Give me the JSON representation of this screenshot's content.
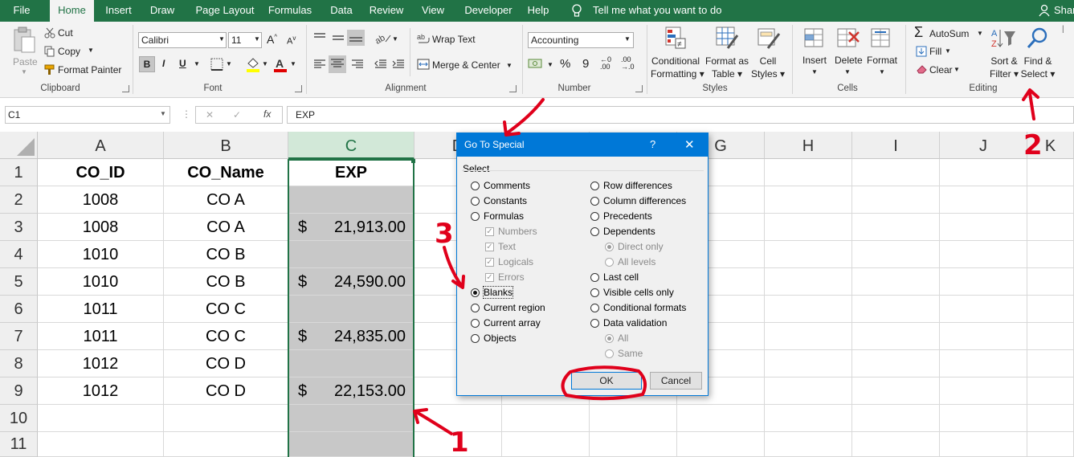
{
  "menu": [
    "File",
    "Home",
    "Insert",
    "Draw",
    "Page Layout",
    "Formulas",
    "Data",
    "Review",
    "View",
    "Developer",
    "Help"
  ],
  "tell_me": "Tell me what you want to do",
  "user": "Shar",
  "clipboard": {
    "paste": "Paste",
    "cut": "Cut",
    "copy": "Copy",
    "format_painter": "Format Painter",
    "label": "Clipboard"
  },
  "font": {
    "name": "Calibri",
    "size": "11",
    "bold": "B",
    "italic": "I",
    "underline": "U",
    "label": "Font"
  },
  "alignment": {
    "wrap": "Wrap Text",
    "merge": "Merge & Center",
    "label": "Alignment"
  },
  "number": {
    "format": "Accounting",
    "percent": "%",
    "comma": "9",
    "inc_dec": ".00",
    "label": "Number"
  },
  "styles": {
    "cond1": "Conditional",
    "cond2": "Formatting",
    "fmt1": "Format as",
    "fmt2": "Table",
    "cell1": "Cell",
    "cell2": "Styles",
    "label": "Styles"
  },
  "cells": {
    "insert": "Insert",
    "delete": "Delete",
    "format": "Format",
    "label": "Cells"
  },
  "editing": {
    "autosum": "AutoSum",
    "fill": "Fill",
    "clear": "Clear",
    "sort1": "Sort &",
    "sort2": "Filter",
    "find1": "Find &",
    "find2": "Select",
    "label": "Editing"
  },
  "formula_bar": {
    "name_box": "C1",
    "formula": "EXP",
    "cancel": "✕",
    "enter": "✓",
    "fx": "fx"
  },
  "columns": [
    "A",
    "B",
    "C",
    "D",
    "E",
    "F",
    "G",
    "H",
    "I",
    "J",
    "K"
  ],
  "rows": [
    "1",
    "2",
    "3",
    "4",
    "5",
    "6",
    "7",
    "8",
    "9",
    "10",
    "11"
  ],
  "header_row": [
    "CO_ID",
    "CO_Name",
    "EXP"
  ],
  "data_rows": [
    [
      "1008",
      "CO A",
      ""
    ],
    [
      "1008",
      "CO A",
      "21,913.00"
    ],
    [
      "1010",
      "CO B",
      ""
    ],
    [
      "1010",
      "CO B",
      "24,590.00"
    ],
    [
      "1011",
      "CO C",
      ""
    ],
    [
      "1011",
      "CO C",
      "24,835.00"
    ],
    [
      "1012",
      "CO D",
      ""
    ],
    [
      "1012",
      "CO D",
      "22,153.00"
    ]
  ],
  "currency_symbol": "$",
  "dialog": {
    "title": "Go To Special",
    "help": "?",
    "close": "✕",
    "section": "Select",
    "left_options": [
      {
        "label": "Comments",
        "type": "radio",
        "selected": false,
        "disabled": false
      },
      {
        "label": "Constants",
        "type": "radio",
        "selected": false,
        "disabled": false
      },
      {
        "label": "Formulas",
        "type": "radio",
        "selected": false,
        "disabled": false
      },
      {
        "label": "Numbers",
        "type": "check",
        "selected": true,
        "disabled": true
      },
      {
        "label": "Text",
        "type": "check",
        "selected": true,
        "disabled": true
      },
      {
        "label": "Logicals",
        "type": "check",
        "selected": true,
        "disabled": true
      },
      {
        "label": "Errors",
        "type": "check",
        "selected": true,
        "disabled": true
      },
      {
        "label": "Blanks",
        "type": "radio",
        "selected": true,
        "disabled": false
      },
      {
        "label": "Current region",
        "type": "radio",
        "selected": false,
        "disabled": false
      },
      {
        "label": "Current array",
        "type": "radio",
        "selected": false,
        "disabled": false
      },
      {
        "label": "Objects",
        "type": "radio",
        "selected": false,
        "disabled": false
      }
    ],
    "right_options": [
      {
        "label": "Row differences",
        "type": "radio",
        "selected": false,
        "disabled": false
      },
      {
        "label": "Column differences",
        "type": "radio",
        "selected": false,
        "disabled": false
      },
      {
        "label": "Precedents",
        "type": "radio",
        "selected": false,
        "disabled": false
      },
      {
        "label": "Dependents",
        "type": "radio",
        "selected": false,
        "disabled": false
      },
      {
        "label": "Direct only",
        "type": "radio",
        "selected": true,
        "disabled": true
      },
      {
        "label": "All levels",
        "type": "radio",
        "selected": false,
        "disabled": true
      },
      {
        "label": "Last cell",
        "type": "radio",
        "selected": false,
        "disabled": false
      },
      {
        "label": "Visible cells only",
        "type": "radio",
        "selected": false,
        "disabled": false
      },
      {
        "label": "Conditional formats",
        "type": "radio",
        "selected": false,
        "disabled": false
      },
      {
        "label": "Data validation",
        "type": "radio",
        "selected": false,
        "disabled": false
      },
      {
        "label": "All",
        "type": "radio",
        "selected": true,
        "disabled": true
      },
      {
        "label": "Same",
        "type": "radio",
        "selected": false,
        "disabled": true
      }
    ],
    "ok": "OK",
    "cancel": "Cancel"
  },
  "annotations": [
    "1",
    "2",
    "3"
  ],
  "colors": {
    "excel_green": "#217346",
    "selection_gray": "#c8c8c8",
    "dialog_blue": "#0078d7",
    "annotation_red": "#e0001b"
  }
}
